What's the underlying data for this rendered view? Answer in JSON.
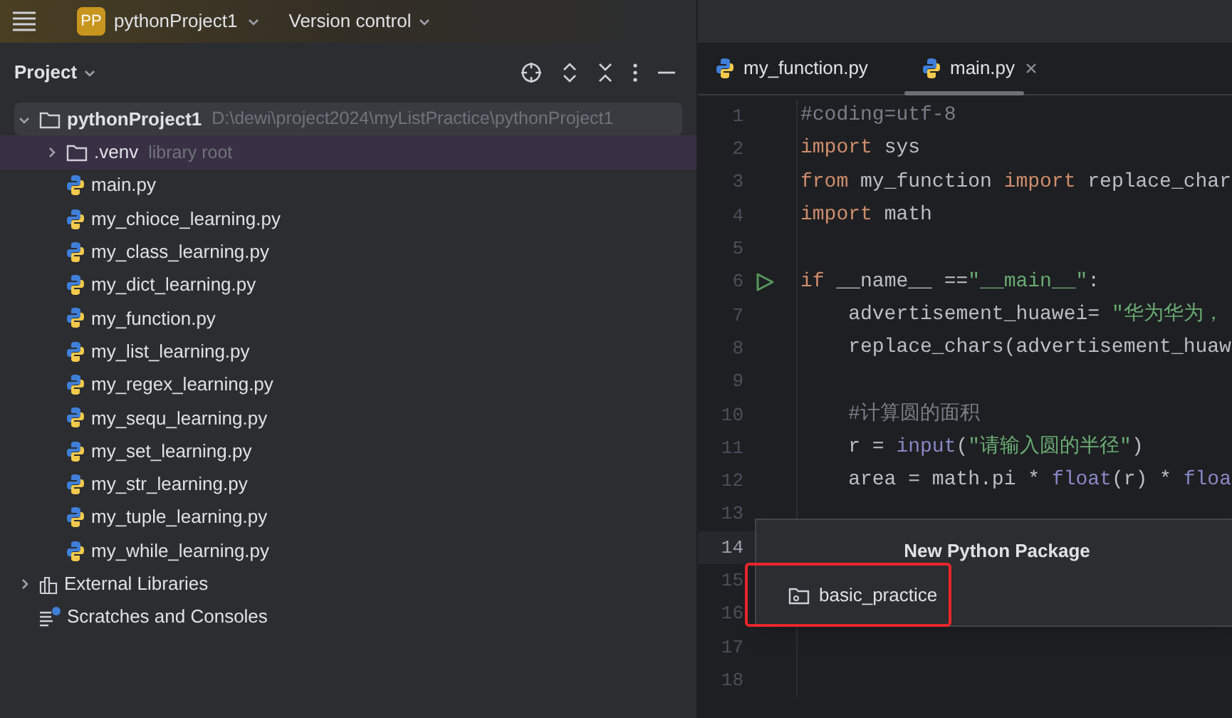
{
  "top_bar": {
    "project_badge": "PP",
    "project": "pythonProject1",
    "vcs": "Version control"
  },
  "project_panel": {
    "title": "Project",
    "tree": [
      {
        "label": "pythonProject1",
        "kind": "project",
        "hint": "D:\\dewi\\project2024\\myListPractice\\pythonProject1",
        "expanded": true,
        "selected": true,
        "marked": false,
        "children": [
          {
            "label": ".venv",
            "kind": "folder",
            "hint": "library root",
            "expanded": false,
            "selected": false,
            "marked": true
          },
          {
            "label": "main.py",
            "kind": "file",
            "selected": false,
            "marked": false
          },
          {
            "label": "my_chioce_learning.py",
            "kind": "file",
            "selected": false,
            "marked": false
          },
          {
            "label": "my_class_learning.py",
            "kind": "file",
            "selected": false,
            "marked": false
          },
          {
            "label": "my_dict_learning.py",
            "kind": "file",
            "selected": false,
            "marked": false
          },
          {
            "label": "my_function.py",
            "kind": "file",
            "selected": false,
            "marked": false
          },
          {
            "label": "my_list_learning.py",
            "kind": "file",
            "selected": false,
            "marked": false
          },
          {
            "label": "my_regex_learning.py",
            "kind": "file",
            "selected": false,
            "marked": false
          },
          {
            "label": "my_sequ_learning.py",
            "kind": "file",
            "selected": false,
            "marked": false
          },
          {
            "label": "my_set_learning.py",
            "kind": "file",
            "selected": false,
            "marked": false
          },
          {
            "label": "my_str_learning.py",
            "kind": "file",
            "selected": false,
            "marked": false
          },
          {
            "label": "my_tuple_learning.py",
            "kind": "file",
            "selected": false,
            "marked": false
          },
          {
            "label": "my_while_learning.py",
            "kind": "file",
            "selected": false,
            "marked": false
          }
        ]
      },
      {
        "label": "External Libraries",
        "kind": "libraries",
        "expanded": false,
        "selected": false,
        "marked": false
      },
      {
        "label": "Scratches and Consoles",
        "kind": "scratches",
        "selected": false,
        "marked": false
      }
    ]
  },
  "editor": {
    "tabs": [
      {
        "label": "my_function.py",
        "selected": false
      },
      {
        "label": "main.py",
        "selected": true
      }
    ],
    "lines": [
      {
        "number": "1",
        "run": false,
        "current": false,
        "tokens": [
          {
            "text": "#coding=utf-8",
            "kind": "comment"
          }
        ]
      },
      {
        "number": "2",
        "run": false,
        "current": false,
        "tokens": [
          {
            "text": "import",
            "kind": "keyword"
          },
          {
            "text": " sys",
            "kind": "plain"
          }
        ]
      },
      {
        "number": "3",
        "run": false,
        "current": false,
        "tokens": [
          {
            "text": "from",
            "kind": "keyword"
          },
          {
            "text": " my_function ",
            "kind": "plain"
          },
          {
            "text": "import",
            "kind": "keyword"
          },
          {
            "text": " replace_char",
            "kind": "plain"
          }
        ]
      },
      {
        "number": "4",
        "run": false,
        "current": false,
        "tokens": [
          {
            "text": "import",
            "kind": "keyword"
          },
          {
            "text": " math",
            "kind": "plain"
          }
        ]
      },
      {
        "number": "5",
        "run": false,
        "current": false
      },
      {
        "number": "6",
        "run": true,
        "current": false,
        "tokens": [
          {
            "text": "if",
            "kind": "keyword"
          },
          {
            "text": " __name__ ==",
            "kind": "plain"
          },
          {
            "text": "\"__main__\"",
            "kind": "string"
          },
          {
            "text": ":",
            "kind": "plain"
          }
        ]
      },
      {
        "number": "7",
        "run": false,
        "current": false,
        "tokens": [
          {
            "text": "    advertisement_huawei= ",
            "kind": "plain"
          },
          {
            "text": "\"华为华为，",
            "kind": "string"
          }
        ]
      },
      {
        "number": "8",
        "run": false,
        "current": false,
        "tokens": [
          {
            "text": "    replace_chars(advertisement_huaw",
            "kind": "plain"
          }
        ]
      },
      {
        "number": "9",
        "run": false,
        "current": false
      },
      {
        "number": "10",
        "run": false,
        "current": false,
        "tokens": [
          {
            "text": "    #计算圆的面积",
            "kind": "comment"
          }
        ]
      },
      {
        "number": "11",
        "run": false,
        "current": false,
        "tokens": [
          {
            "text": "    r = ",
            "kind": "plain"
          },
          {
            "text": "input",
            "kind": "builtin"
          },
          {
            "text": "(",
            "kind": "plain"
          },
          {
            "text": "\"请输入圆的半径\"",
            "kind": "string"
          },
          {
            "text": ")",
            "kind": "plain"
          }
        ]
      },
      {
        "number": "12",
        "run": false,
        "current": false,
        "tokens": [
          {
            "text": "    area = math.pi * ",
            "kind": "plain"
          },
          {
            "text": "float",
            "kind": "builtin"
          },
          {
            "text": "(r) * ",
            "kind": "plain"
          },
          {
            "text": "floa",
            "kind": "builtin"
          }
        ]
      },
      {
        "number": "13",
        "run": false,
        "current": false
      },
      {
        "number": "14",
        "run": false,
        "current": true
      },
      {
        "number": "15",
        "run": false,
        "current": false
      },
      {
        "number": "16",
        "run": false,
        "current": false
      },
      {
        "number": "17",
        "run": false,
        "current": false
      },
      {
        "number": "18",
        "run": false,
        "current": false
      }
    ]
  },
  "popup": {
    "title": "New Python Package",
    "value": "basic_practice",
    "highlighted": true
  }
}
